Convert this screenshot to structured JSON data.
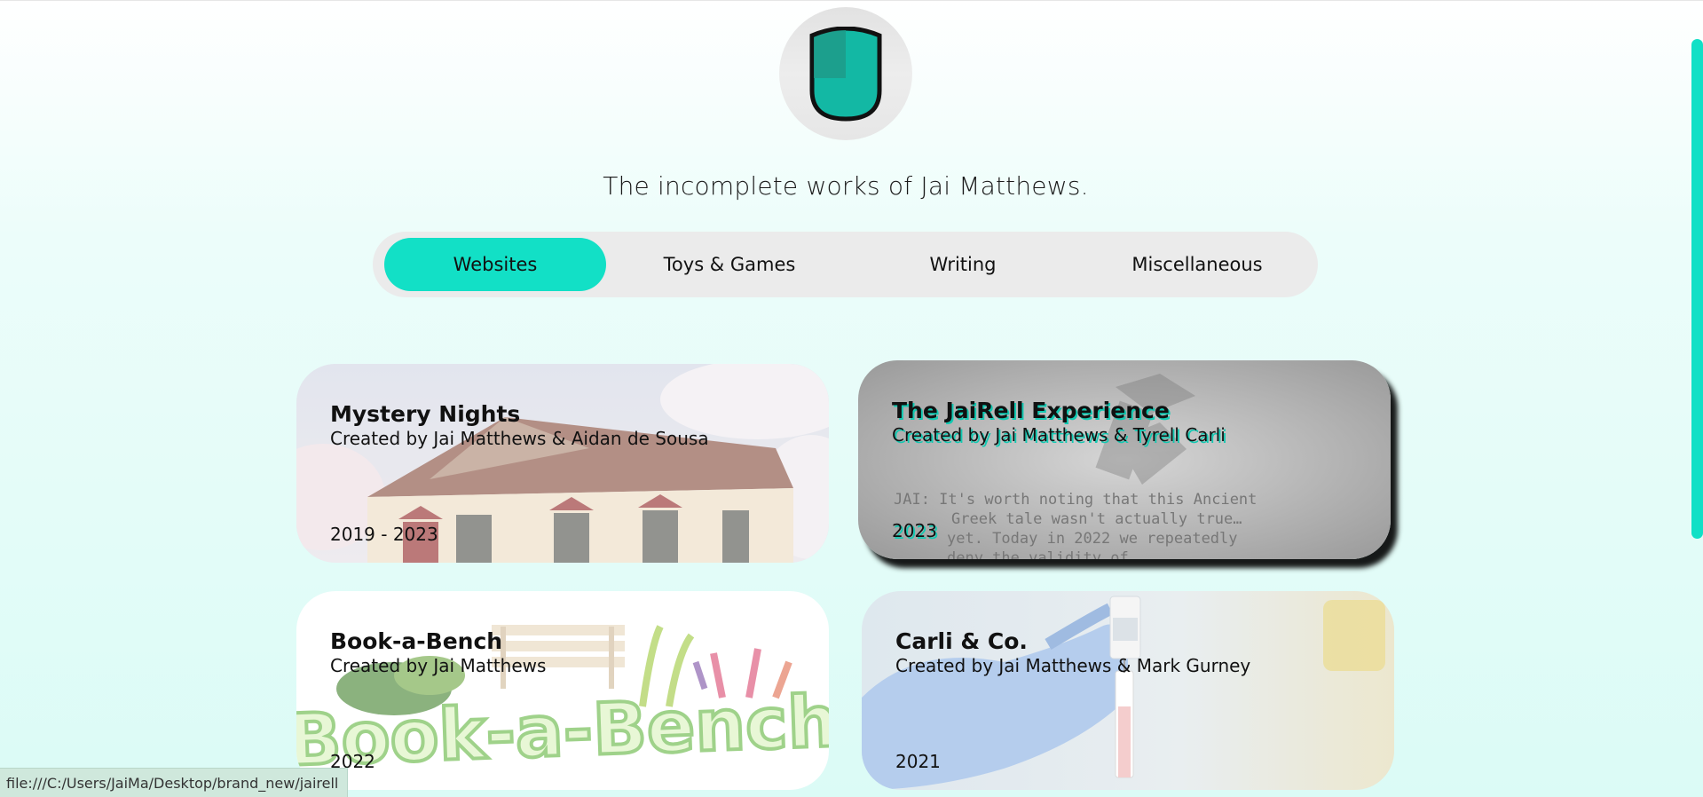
{
  "header": {
    "tagline": "The incomplete works of Jai Matthews.",
    "logo_icon": "shield-icon",
    "accent_color": "#12e0c6"
  },
  "tabs": [
    {
      "label": "Websites",
      "active": true
    },
    {
      "label": "Toys & Games",
      "active": false
    },
    {
      "label": "Writing",
      "active": false
    },
    {
      "label": "Miscellaneous",
      "active": false
    }
  ],
  "cards": [
    {
      "title": "Mystery Nights",
      "subtitle": "Created by Jai Matthews & Aidan de Sousa",
      "year": "2019 - 2023",
      "image": "house-illustration"
    },
    {
      "title": "The JaiRell Experience",
      "subtitle": "Created by Jai Matthews & Tyrell Carli",
      "year": "2023",
      "image": "script-page"
    },
    {
      "title": "Book-a-Bench",
      "subtitle": "Created by Jai Matthews",
      "year": "2022",
      "image": "bench-logo",
      "image_text": "Book-a-Bench"
    },
    {
      "title": "Carli & Co.",
      "subtitle": "Created by Jai Matthews & Mark Gurney",
      "year": "2021",
      "image": "vaccine-photo"
    }
  ],
  "script_lines": [
    "JAI: It's worth noting that this Ancient",
    "Greek tale wasn't actually true…",
    "yet. Today in 2022 we repeatedly",
    "deny the validity of"
  ],
  "status_bar": {
    "url": "file:///C:/Users/JaiMa/Desktop/brand_new/jairell"
  }
}
